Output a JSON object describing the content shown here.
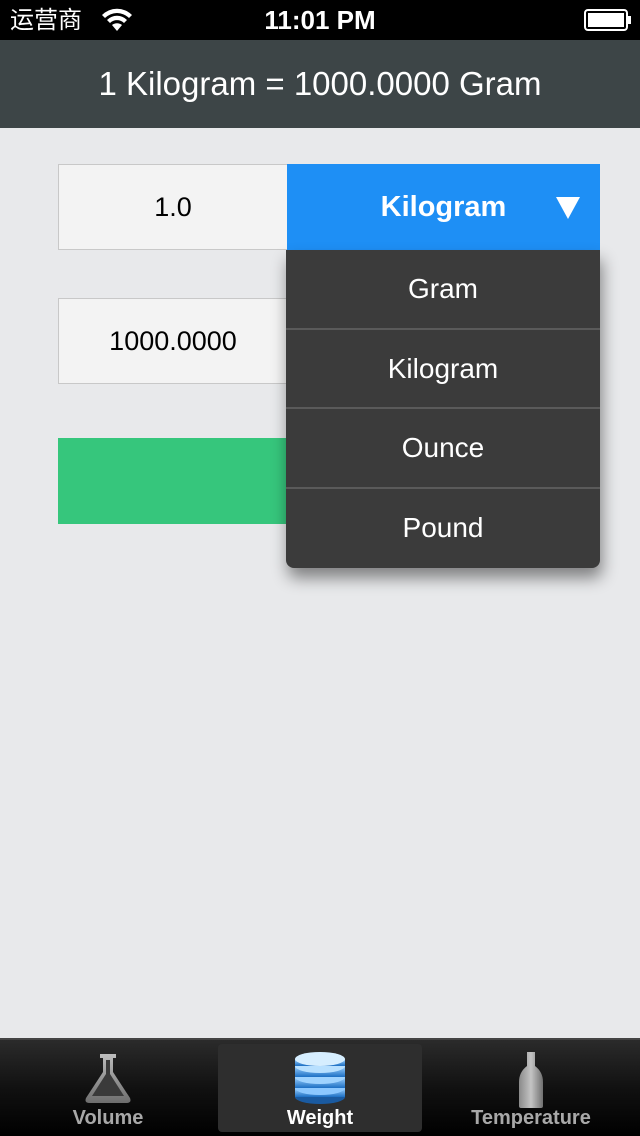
{
  "status_bar": {
    "carrier": "运营商",
    "time": "11:01 PM"
  },
  "header": {
    "title": "1 Kilogram = 1000.0000 Gram"
  },
  "converter": {
    "input_value": "1.0",
    "selected_unit": "Kilogram",
    "output_value": "1000.0000"
  },
  "dropdown": {
    "options": [
      "Gram",
      "Kilogram",
      "Ounce",
      "Pound"
    ]
  },
  "tabbar": {
    "tabs": [
      {
        "label": "Volume",
        "icon": "flask-icon"
      },
      {
        "label": "Weight",
        "icon": "weights-stack-icon"
      },
      {
        "label": "Temperature",
        "icon": "bottle-icon"
      }
    ],
    "active_index": 1
  },
  "colors": {
    "header_bg": "#3d4547",
    "accent_blue": "#1e8ff5",
    "button_green": "#36c67c",
    "dropdown_bg": "#3b3b3b"
  }
}
